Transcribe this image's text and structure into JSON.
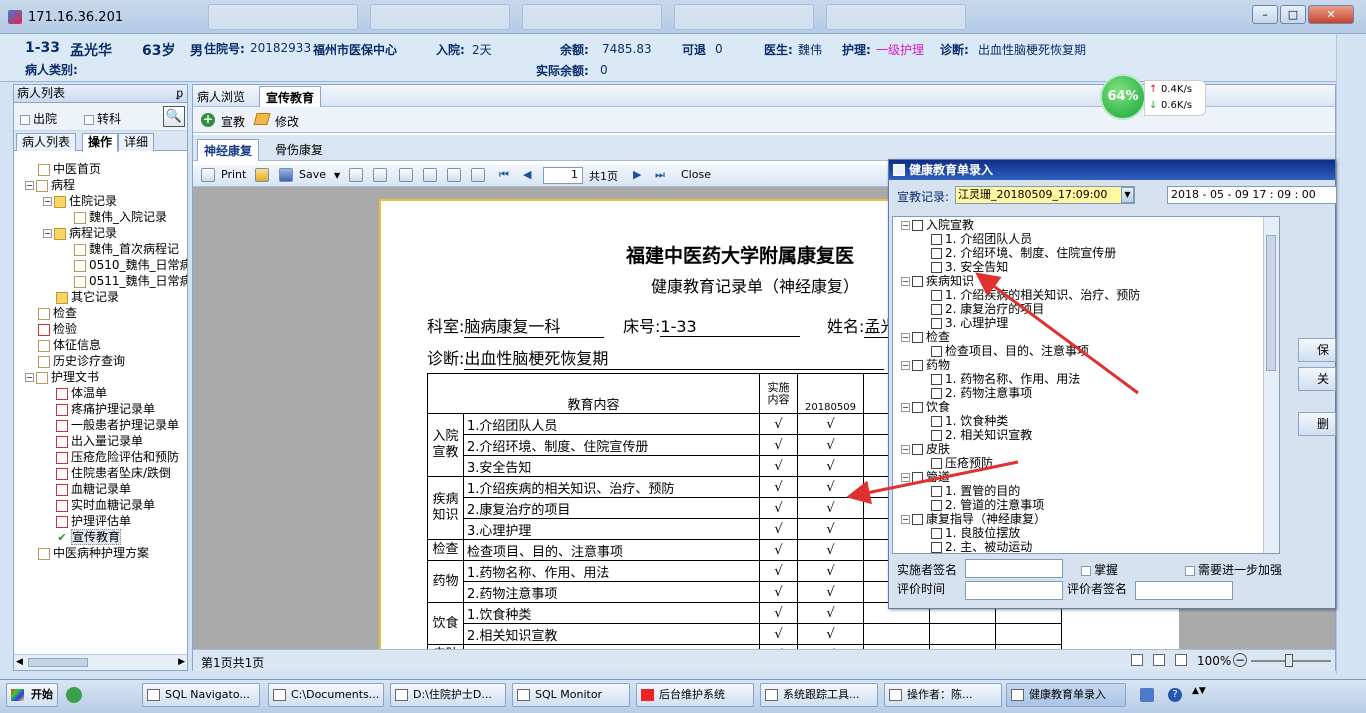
{
  "window": {
    "title": "171.16.36.201",
    "min": "–",
    "max": "□",
    "close": "✕"
  },
  "patient": {
    "bed": "1-33",
    "name": "孟光华",
    "age": "63岁",
    "gender": "男",
    "no_label": "住院号:",
    "no": "20182933",
    "insurer": "福州市医保中心",
    "admit_label": "入院:",
    "admit": "2天",
    "balance_label": "余额:",
    "balance": "7485.83",
    "refund_label": "可退",
    "refund": "0",
    "doctor_label": "医生:",
    "doctor": "魏伟",
    "nursing_label": "护理:",
    "nursing": "一级护理",
    "diag_label": "诊断:",
    "diag": "出血性脑梗死恢复期",
    "category_label": "病人类别:",
    "actual_label": "实际余额:",
    "actual": "0"
  },
  "net": {
    "percent": "64%",
    "up": "0.4K/s",
    "down": "0.6K/s"
  },
  "left": {
    "title": "病人列表",
    "pin": "ᵱ",
    "discharged": "出院",
    "transfer": "转科",
    "tabs": [
      "病人列表",
      "操作",
      "详细"
    ],
    "tree": [
      {
        "label": "中医首页",
        "lvl": 1,
        "ic": "doc"
      },
      {
        "label": "病程",
        "lvl": 1,
        "ic": "doc",
        "pm": "−"
      },
      {
        "label": "住院记录",
        "lvl": 2,
        "ic": "fold",
        "pm": "−"
      },
      {
        "label": "魏伟_入院记录",
        "lvl": 3,
        "ic": "doc"
      },
      {
        "label": "病程记录",
        "lvl": 2,
        "ic": "fold",
        "pm": "−"
      },
      {
        "label": "魏伟_首次病程记",
        "lvl": 3,
        "ic": "doc"
      },
      {
        "label": "0510_魏伟_日常病",
        "lvl": 3,
        "ic": "doc"
      },
      {
        "label": "0511_魏伟_日常病",
        "lvl": 3,
        "ic": "doc"
      },
      {
        "label": "其它记录",
        "lvl": 2,
        "ic": "fold"
      },
      {
        "label": "检查",
        "lvl": 1,
        "ic": "doc"
      },
      {
        "label": "检验",
        "lvl": 1,
        "ic": "red"
      },
      {
        "label": "体征信息",
        "lvl": 1,
        "ic": "doc"
      },
      {
        "label": "历史诊疗查询",
        "lvl": 1,
        "ic": "doc"
      },
      {
        "label": "护理文书",
        "lvl": 1,
        "ic": "doc",
        "pm": "−"
      },
      {
        "label": "体温单",
        "lvl": 2,
        "ic": "red"
      },
      {
        "label": "疼痛护理记录单",
        "lvl": 2,
        "ic": "red"
      },
      {
        "label": "一般患者护理记录单",
        "lvl": 2,
        "ic": "red"
      },
      {
        "label": "出入量记录单",
        "lvl": 2,
        "ic": "red"
      },
      {
        "label": "压疮危险评估和预防",
        "lvl": 2,
        "ic": "red"
      },
      {
        "label": "住院患者坠床/跌倒",
        "lvl": 2,
        "ic": "red"
      },
      {
        "label": "血糖记录单",
        "lvl": 2,
        "ic": "red"
      },
      {
        "label": "实时血糖记录单",
        "lvl": 2,
        "ic": "red"
      },
      {
        "label": "护理评估单",
        "lvl": 2,
        "ic": "red"
      },
      {
        "label": "宣传教育",
        "lvl": 2,
        "ic": "chk"
      },
      {
        "label": "中医病种护理方案",
        "lvl": 1,
        "ic": "doc"
      }
    ]
  },
  "main": {
    "tabs": [
      "病人浏览",
      "宣传教育"
    ],
    "add": "宣教",
    "edit": "修改",
    "subtabs": [
      "神经康复",
      "骨伤康复"
    ],
    "print": "Print",
    "save": "Save",
    "page": "1",
    "page_total": "共1页",
    "close": "Close",
    "status": "第1页共1页",
    "zoom": "100%"
  },
  "doc": {
    "title": "福建中医药大学附属康复医",
    "subtitle": "健康教育记录单（神经康复）",
    "dept_label": "科室:",
    "dept": "脑病康复一科",
    "bed_label": "床号:",
    "bed": "1-33",
    "name_label": "姓名:",
    "name": "孟光",
    "diag_label": "诊断:",
    "diag": "出血性脑梗死恢复期",
    "col_content": "教育内容",
    "col_impl1": "实施",
    "col_impl2": "内容",
    "col_date": "20180509",
    "check": "√",
    "rows": [
      {
        "group": "入院",
        "group2": "宣教",
        "item": "1.介绍团队人员"
      },
      {
        "group": "",
        "group2": "",
        "item": "2.介绍环境、制度、住院宣传册"
      },
      {
        "group": "",
        "group2": "",
        "item": "3.安全告知"
      },
      {
        "group": "疾病",
        "group2": "知识",
        "item": "1.介绍疾病的相关知识、治疗、预防"
      },
      {
        "group": "",
        "group2": "",
        "item": "2.康复治疗的项目"
      },
      {
        "group": "",
        "group2": "",
        "item": "3.心理护理"
      },
      {
        "group": "检查",
        "group2": "",
        "item": "检查项目、目的、注意事项"
      },
      {
        "group": "药物",
        "group2": "",
        "item": "1.药物名称、作用、用法"
      },
      {
        "group": "",
        "group2": "",
        "item": "2.药物注意事项"
      },
      {
        "group": "饮食",
        "group2": "",
        "item": "1.饮食种类"
      },
      {
        "group": "",
        "group2": "",
        "item": "2.相关知识宣教"
      },
      {
        "group": "皮肤",
        "group2": "",
        "item": "压疮预防"
      }
    ]
  },
  "dialog": {
    "title": "健康教育单录入",
    "record_label": "宣教记录:",
    "record": "江灵珊_20180509_17:09:00",
    "date": "2018 - 05 - 09    17 : 09 : 00",
    "tree": [
      {
        "t": "入院宣教",
        "l": 0
      },
      {
        "t": "1. 介绍团队人员",
        "l": 1
      },
      {
        "t": "2. 介绍环境、制度、住院宣传册",
        "l": 1
      },
      {
        "t": "3. 安全告知",
        "l": 1
      },
      {
        "t": "疾病知识",
        "l": 0
      },
      {
        "t": "1. 介绍疾病的相关知识、治疗、预防",
        "l": 1
      },
      {
        "t": "2. 康复治疗的项目",
        "l": 1
      },
      {
        "t": "3. 心理护理",
        "l": 1
      },
      {
        "t": "检查",
        "l": 0
      },
      {
        "t": "检查项目、目的、注意事项",
        "l": 1
      },
      {
        "t": "药物",
        "l": 0
      },
      {
        "t": "1. 药物名称、作用、用法",
        "l": 1
      },
      {
        "t": "2. 药物注意事项",
        "l": 1
      },
      {
        "t": "饮食",
        "l": 0
      },
      {
        "t": "1. 饮食种类",
        "l": 1
      },
      {
        "t": "2. 相关知识宣教",
        "l": 1
      },
      {
        "t": "皮肤",
        "l": 0
      },
      {
        "t": "压疮预防",
        "l": 1
      },
      {
        "t": "管道",
        "l": 0
      },
      {
        "t": "1. 置管的目的",
        "l": 1
      },
      {
        "t": "2. 管道的注意事项",
        "l": 1
      },
      {
        "t": "康复指导（神经康复）",
        "l": 0
      },
      {
        "t": "1. 良肢位摆放",
        "l": 1
      },
      {
        "t": "2. 主、被动运动",
        "l": 1
      }
    ],
    "implementer": "实施者签名",
    "master": "掌握",
    "needmore": "需要进一步加强",
    "evaltime": "评价时间",
    "evaluator": "评价者签名",
    "btn_save": "保",
    "btn_close": "关",
    "btn_del": "删"
  },
  "taskbar": {
    "start": "开始",
    "items": [
      "SQL Navigato...",
      "C:\\Documents...",
      "D:\\住院护士D...",
      "SQL Monitor",
      "后台维护系统",
      "系统跟踪工具...",
      "操作者：陈...",
      "健康教育单录入"
    ]
  },
  "colors": {
    "accent": "#2e5fc2",
    "arrow": "#e03030",
    "nursing": "#d11ec8"
  }
}
